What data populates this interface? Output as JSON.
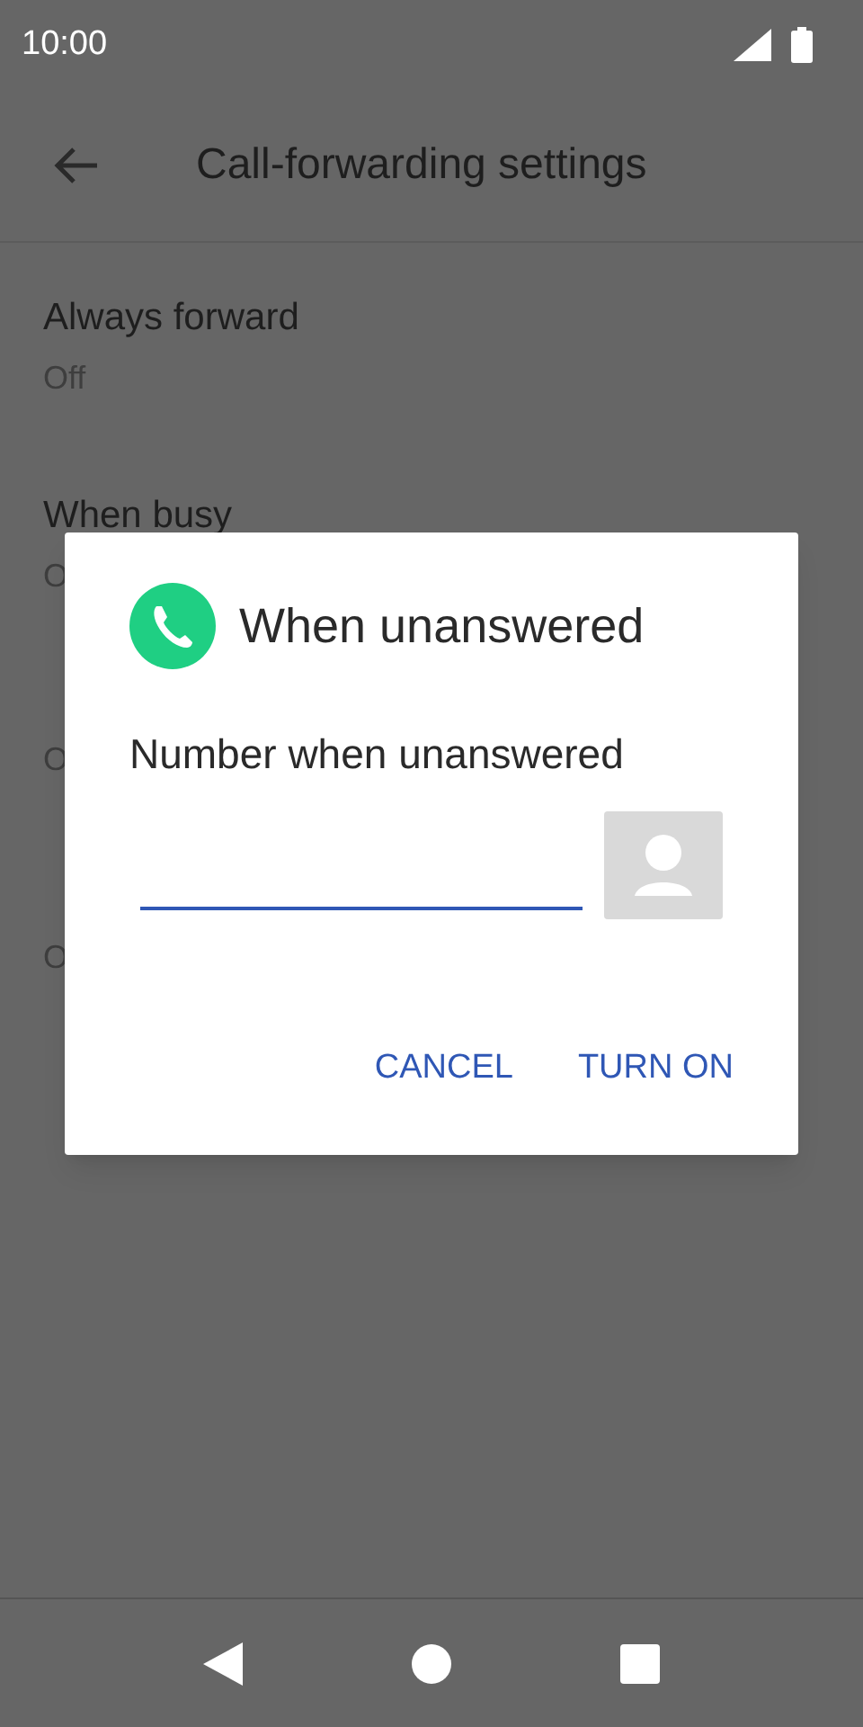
{
  "status_bar": {
    "time": "10:00"
  },
  "header": {
    "title": "Call-forwarding settings"
  },
  "settings": [
    {
      "title": "Always forward",
      "subtitle": "Off"
    },
    {
      "title": "When busy",
      "subtitle": "O"
    },
    {
      "subtitle": "O"
    },
    {
      "subtitle": "O"
    }
  ],
  "dialog": {
    "title": "When unanswered",
    "label": "Number when unanswered",
    "buttons": [
      "CANCEL",
      "TURN ON"
    ]
  }
}
